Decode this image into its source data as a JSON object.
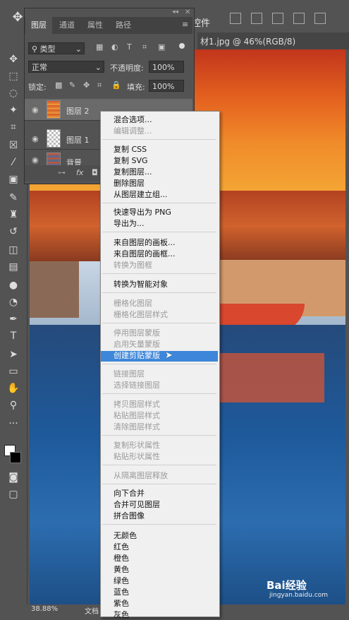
{
  "top_bar": {
    "right_label": "控件"
  },
  "document": {
    "tab_title": "材1.jpg @ 46%(RGB/8)",
    "zoom": "38.88%",
    "status": "文档"
  },
  "layers_panel": {
    "tabs": [
      "图层",
      "通道",
      "属性",
      "路径"
    ],
    "filter_kind": "类型",
    "blend_mode": "正常",
    "opacity_label": "不透明度:",
    "opacity_value": "100%",
    "lock_label": "锁定:",
    "fill_label": "填充:",
    "fill_value": "100%",
    "layers": [
      {
        "name": "图层 2"
      },
      {
        "name": "图层 1"
      },
      {
        "name": "背景"
      }
    ]
  },
  "context_menu": {
    "groups": [
      [
        {
          "label": "混合选项...",
          "enabled": true
        },
        {
          "label": "编辑调整...",
          "enabled": false
        }
      ],
      [
        {
          "label": "复制 CSS",
          "enabled": true
        },
        {
          "label": "复制 SVG",
          "enabled": true
        },
        {
          "label": "复制图层...",
          "enabled": true
        },
        {
          "label": "删除图层",
          "enabled": true
        },
        {
          "label": "从图层建立组...",
          "enabled": true
        }
      ],
      [
        {
          "label": "快速导出为 PNG",
          "enabled": true
        },
        {
          "label": "导出为...",
          "enabled": true
        }
      ],
      [
        {
          "label": "来自图层的画板...",
          "enabled": true
        },
        {
          "label": "来自图层的画框...",
          "enabled": true
        },
        {
          "label": "转换为图框",
          "enabled": false
        }
      ],
      [
        {
          "label": "转换为智能对象",
          "enabled": true
        }
      ],
      [
        {
          "label": "栅格化图层",
          "enabled": false
        },
        {
          "label": "栅格化图层样式",
          "enabled": false
        }
      ],
      [
        {
          "label": "停用图层蒙版",
          "enabled": false
        },
        {
          "label": "启用矢量蒙版",
          "enabled": false
        },
        {
          "label": "创建剪贴蒙版",
          "enabled": true,
          "highlighted": true
        }
      ],
      [
        {
          "label": "链接图层",
          "enabled": false
        },
        {
          "label": "选择链接图层",
          "enabled": false
        }
      ],
      [
        {
          "label": "拷贝图层样式",
          "enabled": false
        },
        {
          "label": "粘贴图层样式",
          "enabled": false
        },
        {
          "label": "清除图层样式",
          "enabled": false
        }
      ],
      [
        {
          "label": "复制形状属性",
          "enabled": false
        },
        {
          "label": "粘贴形状属性",
          "enabled": false
        }
      ],
      [
        {
          "label": "从隔离图层释放",
          "enabled": false
        }
      ],
      [
        {
          "label": "向下合并",
          "enabled": true
        },
        {
          "label": "合并可见图层",
          "enabled": true
        },
        {
          "label": "拼合图像",
          "enabled": true
        }
      ],
      [
        {
          "label": "无颜色",
          "enabled": true
        },
        {
          "label": "红色",
          "enabled": true
        },
        {
          "label": "橙色",
          "enabled": true
        },
        {
          "label": "黄色",
          "enabled": true
        },
        {
          "label": "绿色",
          "enabled": true
        },
        {
          "label": "蓝色",
          "enabled": true
        },
        {
          "label": "紫色",
          "enabled": true
        },
        {
          "label": "灰色",
          "enabled": true
        }
      ]
    ]
  },
  "watermark": {
    "brand": "Bai经验",
    "url": "jingyan.baidu.com"
  }
}
